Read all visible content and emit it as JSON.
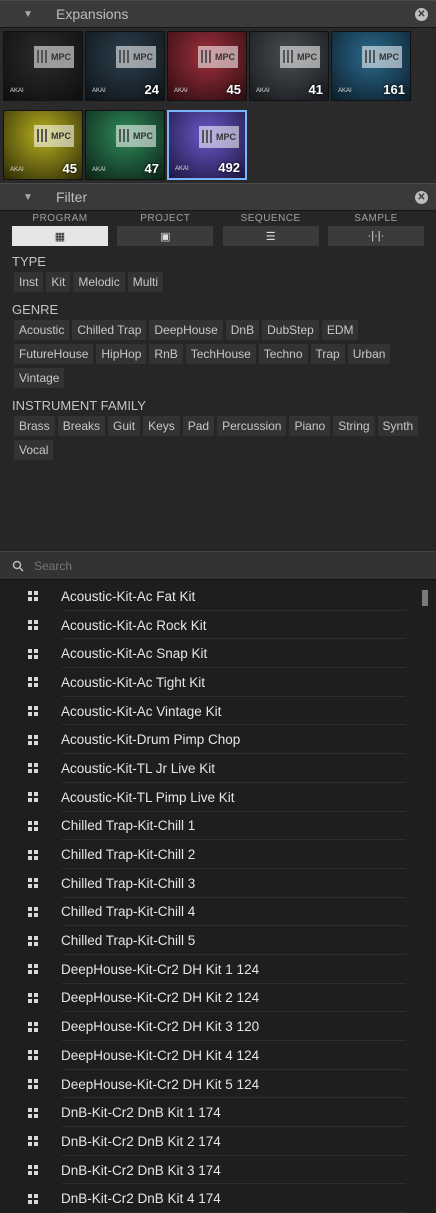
{
  "expansions": {
    "title": "Expansions",
    "tiles": [
      {
        "count": "",
        "colors": [
          "#2c2c2c",
          "#0e0e0e"
        ]
      },
      {
        "count": "24",
        "colors": [
          "#2d3f4d",
          "#0c1318"
        ]
      },
      {
        "count": "45",
        "colors": [
          "#a0303c",
          "#2b0c10"
        ]
      },
      {
        "count": "41",
        "colors": [
          "#4a4f55",
          "#15171a"
        ]
      },
      {
        "count": "161",
        "colors": [
          "#2b6a8f",
          "#0b1d28"
        ]
      },
      {
        "count": "45",
        "colors": [
          "#b8b020",
          "#2c2a06"
        ]
      },
      {
        "count": "47",
        "colors": [
          "#2f8a5a",
          "#0b2116"
        ]
      },
      {
        "count": "492",
        "colors": [
          "#6a58c8",
          "#1c1640"
        ]
      }
    ]
  },
  "filter": {
    "title": "Filter",
    "type_tabs": [
      {
        "label": "PROGRAM",
        "icon": "grid-icon",
        "glyph": "▦",
        "active": true
      },
      {
        "label": "PROJECT",
        "icon": "document-icon",
        "glyph": "▣",
        "active": false
      },
      {
        "label": "SEQUENCE",
        "icon": "sequence-icon",
        "glyph": "☰",
        "active": false
      },
      {
        "label": "SAMPLE",
        "icon": "waveform-icon",
        "glyph": "·|·|·",
        "active": false
      }
    ],
    "type": {
      "title": "TYPE",
      "items": [
        "Inst",
        "Kit",
        "Melodic",
        "Multi"
      ]
    },
    "genre": {
      "title": "GENRE",
      "items": [
        "Acoustic",
        "Chilled Trap",
        "DeepHouse",
        "DnB",
        "DubStep",
        "EDM",
        "FutureHouse",
        "HipHop",
        "RnB",
        "TechHouse",
        "Techno",
        "Trap",
        "Urban",
        "Vintage"
      ]
    },
    "family": {
      "title": "INSTRUMENT FAMILY",
      "items": [
        "Brass",
        "Breaks",
        "Guit",
        "Keys",
        "Pad",
        "Percussion",
        "Piano",
        "String",
        "Synth",
        "Vocal"
      ]
    }
  },
  "search": {
    "placeholder": "Search"
  },
  "programs": [
    "Acoustic-Kit-Ac Fat Kit",
    "Acoustic-Kit-Ac Rock Kit",
    "Acoustic-Kit-Ac Snap Kit",
    "Acoustic-Kit-Ac Tight Kit",
    "Acoustic-Kit-Ac Vintage Kit",
    "Acoustic-Kit-Drum Pimp Chop",
    "Acoustic-Kit-TL Jr Live Kit",
    "Acoustic-Kit-TL Pimp Live Kit",
    "Chilled Trap-Kit-Chill 1",
    "Chilled Trap-Kit-Chill 2",
    "Chilled Trap-Kit-Chill 3",
    "Chilled Trap-Kit-Chill 4",
    "Chilled Trap-Kit-Chill 5",
    "DeepHouse-Kit-Cr2 DH Kit 1 124",
    "DeepHouse-Kit-Cr2 DH Kit 2 124",
    "DeepHouse-Kit-Cr2 DH Kit 3 120",
    "DeepHouse-Kit-Cr2 DH Kit 4 124",
    "DeepHouse-Kit-Cr2 DH Kit 5 124",
    "DnB-Kit-Cr2 DnB Kit 1 174",
    "DnB-Kit-Cr2 DnB Kit 2 174",
    "DnB-Kit-Cr2 DnB Kit 3 174",
    "DnB-Kit-Cr2 DnB Kit 4 174"
  ]
}
